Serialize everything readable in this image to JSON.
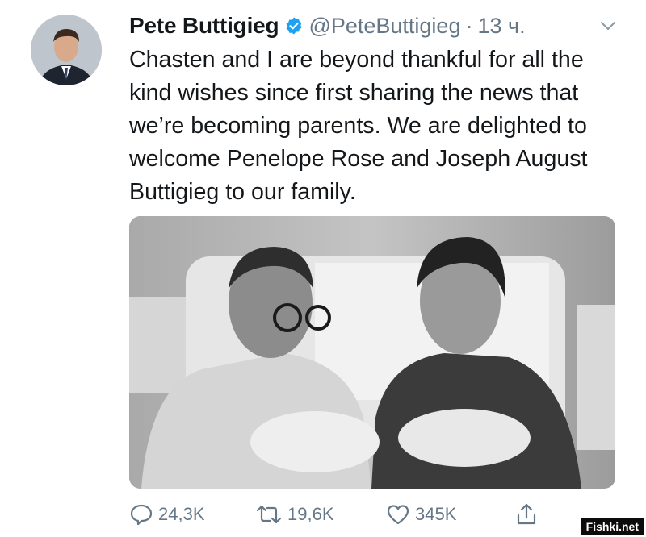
{
  "tweet": {
    "display_name": "Pete Buttigieg",
    "handle": "@PeteButtigieg",
    "separator": "·",
    "timestamp": "13 ч.",
    "text": "Chasten and I are beyond thankful for all the kind wishes since first sharing the news that we’re becoming parents. We are delighted to welcome Penelope Rose and Joseph August Buttigieg to our family.",
    "photo_alt": "Pete and Chasten Buttigieg holding their newborn twins in a hospital bed"
  },
  "actions": {
    "reply_count": "24,3K",
    "retweet_count": "19,6K",
    "like_count": "345K"
  },
  "icons": {
    "verified": "verified-badge-icon",
    "caret": "chevron-down-icon",
    "reply": "reply-icon",
    "retweet": "retweet-icon",
    "like": "heart-icon",
    "share": "share-icon"
  },
  "colors": {
    "verified": "#1da1f2",
    "muted": "#657786",
    "text": "#14171a"
  },
  "watermark": "Fishki.net"
}
